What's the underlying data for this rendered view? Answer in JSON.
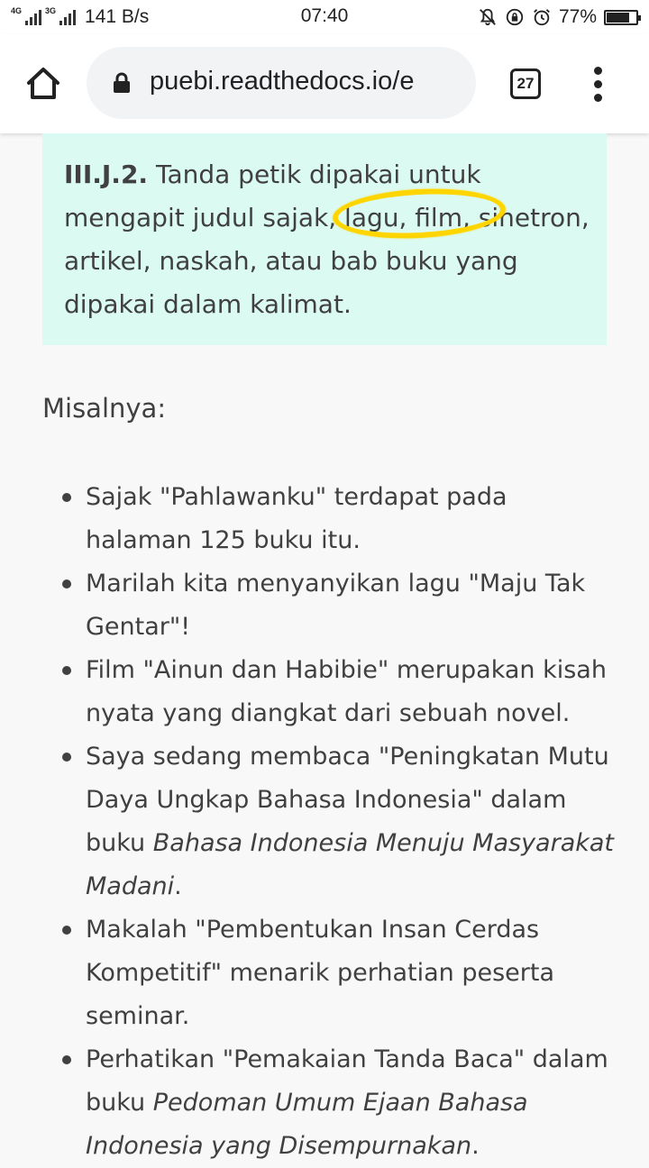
{
  "status_bar": {
    "network_left": "4G",
    "network_right": "3G",
    "speed": "141 B/s",
    "time": "07:40",
    "battery_percent_text": "77%",
    "battery_level": 0.77
  },
  "browser": {
    "url": "puebi.readthedocs.io/e",
    "tab_count": "27"
  },
  "rule": {
    "code": "III.J.2.",
    "text": " Tanda petik dipakai untuk mengapit judul sajak, lagu, film, sinetron, artikel, naskah, atau bab buku yang dipakai dalam kalimat."
  },
  "examples_heading": "Misalnya:",
  "examples": [
    {
      "before": "Sajak \"Pahlawanku\" terdapat pada halaman 125 buku itu.",
      "italic": "",
      "after": ""
    },
    {
      "before": "Marilah kita menyanyikan lagu \"Maju Tak Gentar\"!",
      "italic": "",
      "after": ""
    },
    {
      "before": "Film \"Ainun dan Habibie\" merupakan kisah nyata yang diangkat dari sebuah novel.",
      "italic": "",
      "after": ""
    },
    {
      "before": "Saya sedang membaca \"Peningkatan Mutu Daya Ungkap Bahasa Indonesia\" dalam buku ",
      "italic": "Bahasa Indonesia Menuju Masyarakat Madani",
      "after": "."
    },
    {
      "before": "Makalah \"Pembentukan Insan Cerdas Kompetitif\" menarik perhatian peserta seminar.",
      "italic": "",
      "after": ""
    },
    {
      "before": "Perhatikan \"Pemakaian Tanda Baca\" dalam buku ",
      "italic": "Pedoman Umum Ejaan Bahasa Indonesia yang Disempurnakan",
      "after": "."
    }
  ],
  "colors": {
    "note_background": "#dbfaf1",
    "highlight": "#ffd500",
    "text": "#404040"
  }
}
